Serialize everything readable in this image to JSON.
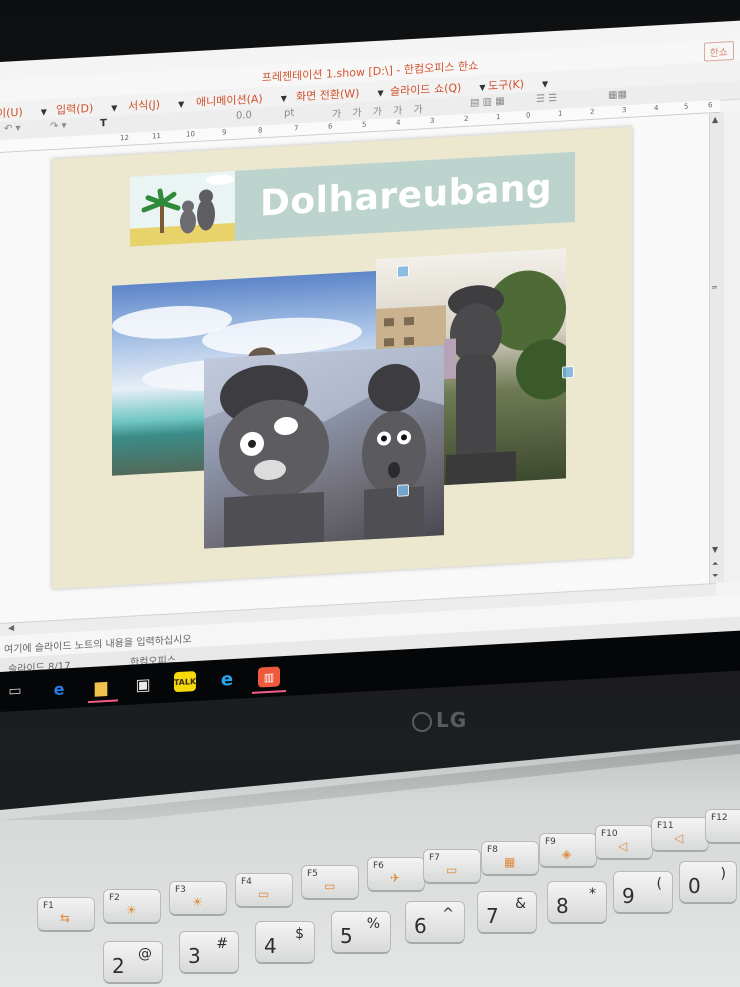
{
  "window": {
    "title": "프레젠테이션 1.show [D:\\] - 한컴오피스 한쇼",
    "app_chip": "한쇼"
  },
  "menu": {
    "items": [
      "이(U)",
      "입력(D)",
      "서식(J)",
      "애니메이션(A)",
      "화면 전환(W)",
      "슬라이드 쇼(Q)",
      "도구(K)"
    ]
  },
  "toolbar": {
    "font_size": "0.0",
    "unit": "pt"
  },
  "ruler": {
    "ticks": [
      "12",
      "11",
      "10",
      "9",
      "8",
      "7",
      "6",
      "5",
      "4",
      "3",
      "2",
      "1",
      "0",
      "1",
      "2",
      "3",
      "4",
      "5",
      "6"
    ]
  },
  "slide": {
    "title": "Dolhareubang"
  },
  "notes": {
    "placeholder": "여기에 슬라이드 노트의 내용을 입력하십시오"
  },
  "status": {
    "slide_counter": "슬라이드 8/17",
    "app_name": "한컴오피스"
  },
  "taskbar": {
    "icons": [
      "task-view-icon",
      "edge-icon",
      "file-explorer-icon",
      "store-icon",
      "kakaotalk-icon",
      "internet-explorer-icon",
      "hancom-show-icon"
    ],
    "kakao_label": "TALK"
  },
  "brand": {
    "logo": "LG"
  },
  "keyboard": {
    "fn_row": [
      "F1",
      "F2",
      "F3",
      "F4",
      "F5",
      "F6",
      "F7",
      "F8",
      "F9",
      "F10",
      "F11",
      "F12"
    ],
    "num_row": [
      {
        "main": "2",
        "shift": "@"
      },
      {
        "main": "3",
        "shift": "#"
      },
      {
        "main": "4",
        "shift": "$"
      },
      {
        "main": "5",
        "shift": "%"
      },
      {
        "main": "6",
        "shift": "^"
      },
      {
        "main": "7",
        "shift": "&"
      },
      {
        "main": "8",
        "shift": "*"
      },
      {
        "main": "9",
        "shift": "("
      },
      {
        "main": "0",
        "shift": ")"
      }
    ]
  },
  "colors": {
    "menu_text": "#d0502b",
    "slide_bg": "#ece7cf",
    "title_banner": "#bcd3ce"
  }
}
